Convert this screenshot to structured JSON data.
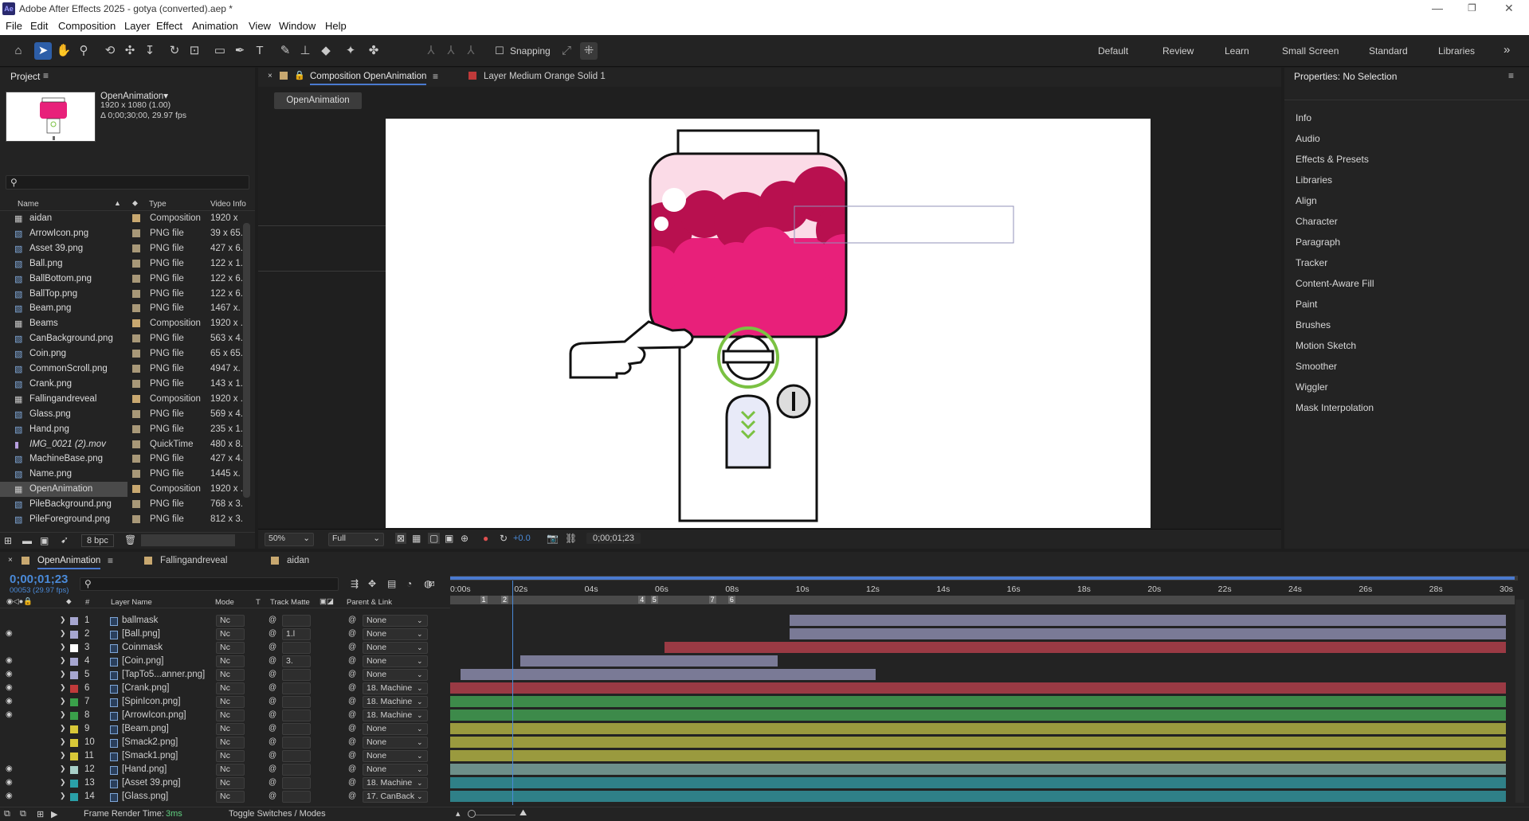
{
  "app": {
    "title": "Adobe After Effects 2025 - gotya (converted).aep *",
    "logo": "Ae"
  },
  "menu": [
    "File",
    "Edit",
    "Composition",
    "Layer",
    "Effect",
    "Animation",
    "View",
    "Window",
    "Help"
  ],
  "toolbar": {
    "snapping_label": "Snapping",
    "workspaces": [
      "Default",
      "Review",
      "Learn",
      "Small Screen",
      "Standard",
      "Libraries"
    ]
  },
  "project": {
    "title": "Project",
    "preview": {
      "name": "OpenAnimation▾",
      "size": "1920 x 1080 (1.00)",
      "duration": "Δ 0;00;30;00, 29.97 fps"
    },
    "columns": {
      "name": "Name",
      "type": "Type",
      "video_info": "Video Info"
    },
    "items": [
      {
        "name": "aidan",
        "type": "Composition",
        "info": "1920 x",
        "kind": "comp",
        "selected": false,
        "italic": false
      },
      {
        "name": "ArrowIcon.png",
        "type": "PNG file",
        "info": "39 x 65.",
        "kind": "png",
        "selected": false,
        "italic": false
      },
      {
        "name": "Asset 39.png",
        "type": "PNG file",
        "info": "427 x 6.",
        "kind": "png",
        "selected": false,
        "italic": false
      },
      {
        "name": "Ball.png",
        "type": "PNG file",
        "info": "122 x 1.",
        "kind": "png",
        "selected": false,
        "italic": false
      },
      {
        "name": "BallBottom.png",
        "type": "PNG file",
        "info": "122 x 6.",
        "kind": "png",
        "selected": false,
        "italic": false
      },
      {
        "name": "BallTop.png",
        "type": "PNG file",
        "info": "122 x 6.",
        "kind": "png",
        "selected": false,
        "italic": false
      },
      {
        "name": "Beam.png",
        "type": "PNG file",
        "info": "1467 x.",
        "kind": "png",
        "selected": false,
        "italic": false
      },
      {
        "name": "Beams",
        "type": "Composition",
        "info": "1920 x .",
        "kind": "comp",
        "selected": false,
        "italic": false
      },
      {
        "name": "CanBackground.png",
        "type": "PNG file",
        "info": "563 x 4.",
        "kind": "png",
        "selected": false,
        "italic": false
      },
      {
        "name": "Coin.png",
        "type": "PNG file",
        "info": "65 x 65.",
        "kind": "png",
        "selected": false,
        "italic": false
      },
      {
        "name": "CommonScroll.png",
        "type": "PNG file",
        "info": "4947 x.",
        "kind": "png",
        "selected": false,
        "italic": false
      },
      {
        "name": "Crank.png",
        "type": "PNG file",
        "info": "143 x 1.",
        "kind": "png",
        "selected": false,
        "italic": false
      },
      {
        "name": "Fallingandreveal",
        "type": "Composition",
        "info": "1920 x .",
        "kind": "comp",
        "selected": false,
        "italic": false
      },
      {
        "name": "Glass.png",
        "type": "PNG file",
        "info": "569 x 4.",
        "kind": "png",
        "selected": false,
        "italic": false
      },
      {
        "name": "Hand.png",
        "type": "PNG file",
        "info": "235 x 1.",
        "kind": "png",
        "selected": false,
        "italic": false
      },
      {
        "name": "IMG_0021 (2).mov",
        "type": "QuickTime",
        "info": "480 x 8.",
        "kind": "mov",
        "selected": false,
        "italic": true
      },
      {
        "name": "MachineBase.png",
        "type": "PNG file",
        "info": "427 x 4.",
        "kind": "png",
        "selected": false,
        "italic": false
      },
      {
        "name": "Name.png",
        "type": "PNG file",
        "info": "1445 x.",
        "kind": "png",
        "selected": false,
        "italic": false
      },
      {
        "name": "OpenAnimation",
        "type": "Composition",
        "info": "1920 x .",
        "kind": "comp",
        "selected": true,
        "italic": false
      },
      {
        "name": "PileBackground.png",
        "type": "PNG file",
        "info": "768 x 3.",
        "kind": "png",
        "selected": false,
        "italic": false
      },
      {
        "name": "PileForeground.png",
        "type": "PNG file",
        "info": "812 x 3.",
        "kind": "png",
        "selected": false,
        "italic": false
      }
    ],
    "bpc": "8 bpc"
  },
  "comp": {
    "tab_label": "Composition OpenAnimation",
    "layer_tab_label": "Layer Medium Orange Solid 1",
    "breadcrumb": "OpenAnimation",
    "zoom": "50%",
    "resolution": "Full",
    "exposure": "+0.0",
    "timecode": "0;00;01;23",
    "colors": {
      "pink": "#e8207a",
      "dark_pink": "#b8104f",
      "green": "#7ac142"
    }
  },
  "properties": {
    "title": "Properties: No Selection",
    "panels": [
      "Info",
      "Audio",
      "Effects & Presets",
      "Libraries",
      "Align",
      "Character",
      "Paragraph",
      "Tracker",
      "Content-Aware Fill",
      "Paint",
      "Brushes",
      "Motion Sketch",
      "Smoother",
      "Wiggler",
      "Mask Interpolation"
    ]
  },
  "timeline": {
    "tabs": [
      "OpenAnimation",
      "Fallingandreveal",
      "aidan"
    ],
    "timecode": "0;00;01;23",
    "frame_info": "00053 (29.97 fps)",
    "columns": {
      "num": "#",
      "layer_name": "Layer Name",
      "mode": "Mode",
      "t": "T",
      "track_matte": "Track Matte",
      "parent": "Parent & Link"
    },
    "ruler": [
      "0:00s",
      "02s",
      "04s",
      "06s",
      "08s",
      "10s",
      "12s",
      "14s",
      "16s",
      "18s",
      "20s",
      "22s",
      "24s",
      "26s",
      "28s",
      "30s"
    ],
    "markers": [
      "1",
      "2",
      "4",
      "5",
      "7",
      "6"
    ],
    "duration_seconds": 30,
    "playhead_seconds": 1.77,
    "layers": [
      {
        "num": "1",
        "name": "ballmask",
        "mode": "Nc",
        "matte": "",
        "parent": "None",
        "color": "#a6a6d0",
        "bar_color": "#7a7a96",
        "start": 9.65,
        "end": 30,
        "visible": false
      },
      {
        "num": "2",
        "name": "[Ball.png]",
        "mode": "Nc",
        "matte": "1.l",
        "parent": "None",
        "color": "#a6a6d0",
        "bar_color": "#7a7a96",
        "start": 9.65,
        "end": 30,
        "visible": true
      },
      {
        "num": "3",
        "name": "Coinmask",
        "mode": "Nc",
        "matte": "",
        "parent": "None",
        "color": "#ffffff",
        "bar_color": "#9a3a44",
        "start": 6.1,
        "end": 30,
        "visible": false
      },
      {
        "num": "4",
        "name": "[Coin.png]",
        "mode": "Nc",
        "matte": "3.",
        "parent": "None",
        "color": "#a6a6d0",
        "bar_color": "#7a7a96",
        "start": 2.0,
        "end": 9.3,
        "visible": true
      },
      {
        "num": "5",
        "name": "[TapTo5...anner.png]",
        "mode": "Nc",
        "matte": "",
        "parent": "None",
        "color": "#a6a6d0",
        "bar_color": "#7a7a96",
        "start": 0.3,
        "end": 12.1,
        "visible": true
      },
      {
        "num": "6",
        "name": "[Crank.png]",
        "mode": "Nc",
        "matte": "",
        "parent": "18. Machine",
        "color": "#c03a3a",
        "bar_color": "#9a3a44",
        "start": 0,
        "end": 30,
        "visible": true
      },
      {
        "num": "7",
        "name": "[SpinIcon.png]",
        "mode": "Nc",
        "matte": "",
        "parent": "18. Machine",
        "color": "#3aa04a",
        "bar_color": "#3d8a4a",
        "start": 0,
        "end": 30,
        "visible": true
      },
      {
        "num": "8",
        "name": "[ArrowIcon.png]",
        "mode": "Nc",
        "matte": "",
        "parent": "18. Machine",
        "color": "#3aa04a",
        "bar_color": "#3d8a4a",
        "start": 0,
        "end": 30,
        "visible": true
      },
      {
        "num": "9",
        "name": "[Beam.png]",
        "mode": "Nc",
        "matte": "",
        "parent": "None",
        "color": "#d8c838",
        "bar_color": "#9a9a3e",
        "start": 0,
        "end": 30,
        "visible": false
      },
      {
        "num": "10",
        "name": "[Smack2.png]",
        "mode": "Nc",
        "matte": "",
        "parent": "None",
        "color": "#d8c838",
        "bar_color": "#9a9a3e",
        "start": 0,
        "end": 30,
        "visible": false
      },
      {
        "num": "11",
        "name": "[Smack1.png]",
        "mode": "Nc",
        "matte": "",
        "parent": "None",
        "color": "#d8c838",
        "bar_color": "#9a9a3e",
        "start": 0,
        "end": 30,
        "visible": false
      },
      {
        "num": "12",
        "name": "[Hand.png]",
        "mode": "Nc",
        "matte": "",
        "parent": "None",
        "color": "#a8d0c8",
        "bar_color": "#6d8f8a",
        "start": 0,
        "end": 30,
        "visible": true
      },
      {
        "num": "13",
        "name": "[Asset 39.png]",
        "mode": "Nc",
        "matte": "",
        "parent": "18. Machine",
        "color": "#2aa0a8",
        "bar_color": "#2f8088",
        "start": 0,
        "end": 30,
        "visible": true
      },
      {
        "num": "14",
        "name": "[Glass.png]",
        "mode": "Nc",
        "matte": "",
        "parent": "17. CanBack",
        "color": "#2aa0a8",
        "bar_color": "#2f8088",
        "start": 0,
        "end": 30,
        "visible": true
      }
    ],
    "footer": {
      "render_label": "Frame Render Time:",
      "render_value": "3ms",
      "toggle_label": "Toggle Switches / Modes"
    }
  }
}
